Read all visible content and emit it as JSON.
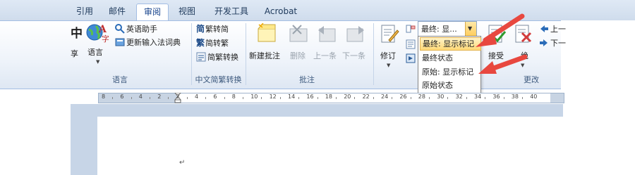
{
  "tabs": [
    {
      "label": "引用",
      "active": false
    },
    {
      "label": "邮件",
      "active": false
    },
    {
      "label": "审阅",
      "active": true
    },
    {
      "label": "视图",
      "active": false
    },
    {
      "label": "开发工具",
      "active": false
    },
    {
      "label": "Acrobat",
      "active": false
    }
  ],
  "ribbon": {
    "partial_left": {
      "glyph": "中",
      "label": "享"
    },
    "language_group": {
      "name": "语言",
      "language_button": "语言",
      "english_assistant": "英语助手",
      "update_ime": "更新输入法词典"
    },
    "chinese_group": {
      "name": "中文简繁转换",
      "trad_to_simp": "繁转简",
      "simp_to_trad": "简转繁",
      "conversion": "简繁转换"
    },
    "comments_group": {
      "name": "批注",
      "new_comment": "新建批注",
      "delete": "删除",
      "previous": "上一条",
      "next": "下一条"
    },
    "tracking_group": {
      "track_changes": "修订",
      "display_combo_value": "最终: 显..."
    },
    "changes_group": {
      "name": "更改",
      "accept": "接受",
      "reject": "绝",
      "previous": "上一",
      "next": "下一"
    }
  },
  "dropdown": {
    "items": [
      {
        "label": "最终: 显示标记",
        "selected": true
      },
      {
        "label": "最终状态",
        "selected": false
      },
      {
        "label": "原始: 显示标记",
        "selected": false
      },
      {
        "label": "原始状态",
        "selected": false
      }
    ]
  },
  "ruler": {
    "ticks": [
      "8",
      "6",
      "4",
      "2",
      "2",
      "4",
      "6",
      "8",
      "10",
      "12",
      "14",
      "16",
      "18",
      "20",
      "22",
      "24",
      "26",
      "28",
      "30",
      "32",
      "34",
      "36",
      "38",
      "40"
    ]
  },
  "document": {
    "paragraph_mark": "↵"
  },
  "colors": {
    "accent": "#1e395b",
    "highlight": "#ffd977",
    "arrow": "#e8483f"
  },
  "icons": {
    "language": "language-icon",
    "english_assistant": "english-assistant-icon",
    "new_comment": "new-comment-icon",
    "track_changes": "track-changes-icon",
    "accept": "accept-icon",
    "reject": "reject-icon"
  }
}
